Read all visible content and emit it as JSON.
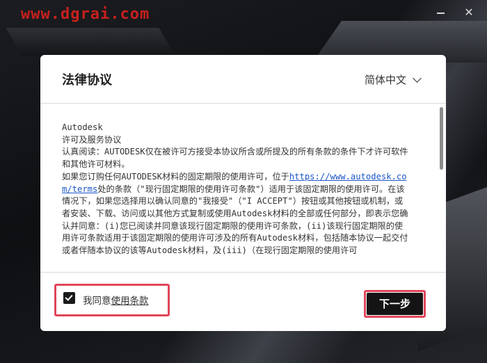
{
  "watermark": "www.dgrai.com",
  "window": {
    "minimize_icon": "minimize-icon",
    "close_glyph": "✕"
  },
  "dialog": {
    "title": "法律协议",
    "language": {
      "selected": "简体中文",
      "icon": "chevron-down-icon"
    },
    "license": {
      "lines_before_link": "Autodesk\n许可及服务协议\n认真阅读：AUTODESK仅在被许可方接受本协议所含或所提及的所有条款的条件下才许可软件和其他许可材料。\n如果您订购任何AUTODESK材料的固定期限的使用许可，位于",
      "link": "https://www.autodesk.com/terms",
      "lines_after_link": "处的条款（\"现行固定期限的使用许可条款\"）适用于该固定期限的使用许可。在该情况下，如果您选择用以确认同意的\"我接受\"（\"I ACCEPT\"）按钮或其他按钮或机制，或者安装、下载、访问或以其他方式复制或使用Autodesk材料的全部或任何部分，即表示您确认并同意：(i)您已阅读并同意该现行固定期限的使用许可条款，(ii)该现行固定期限的使用许可条款适用于该固定期限的使用许可涉及的所有Autodesk材料，包括随本协议一起交付或者伴随本协议的该等Autodesk材料，及(iii)（在现行固定期限的使用许可"
    },
    "agree": {
      "checked": true,
      "prefix": "我同意",
      "link_text": "使用条款"
    },
    "next_button": "下一步",
    "highlight_color": "#e0465a"
  }
}
